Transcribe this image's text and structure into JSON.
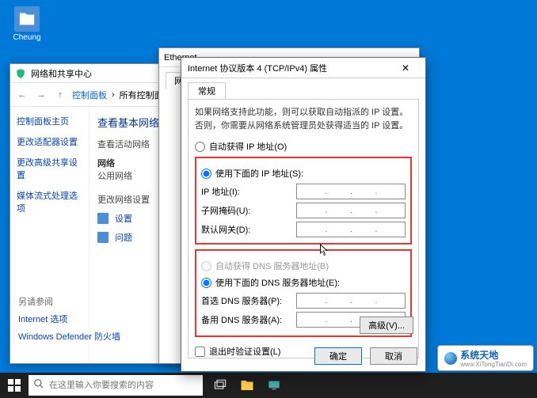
{
  "desktop": {
    "user_label": "Cheung"
  },
  "cp": {
    "title": "网络和共享中心",
    "crumbs": {
      "c1": "控制面板",
      "c2": "所有控制面板"
    },
    "side": {
      "home": "控制面板主页",
      "adapter": "更改适配器设置",
      "sharing": "更改高级共享设置",
      "media": "媒体流式处理选项"
    },
    "main": {
      "heading": "查看基本网络",
      "netinfo": "查看活动网络",
      "net_label": "网络",
      "net_type": "公用网络",
      "change_head": "更改网络设置",
      "setup": "设置",
      "diag": "问题"
    },
    "see": {
      "title": "另请参阅",
      "l1": "Internet 选项",
      "l2": "Windows Defender 防火墙"
    }
  },
  "eth": {
    "title": "Ethernet",
    "tab": "网络"
  },
  "tcp": {
    "title": "Internet 协议版本 4 (TCP/IPv4) 属性",
    "tab": "常规",
    "desc": "如果网络支持此功能，则可以获取自动指派的 IP 设置。否则，你需要从网络系统管理员处获得适当的 IP 设置。",
    "auto_ip": "自动获得 IP 地址(O)",
    "use_ip": "使用下面的 IP 地址(S):",
    "ip_label": "IP 地址(I):",
    "mask_label": "子网掩码(U):",
    "gw_label": "默认网关(D):",
    "auto_dns": "自动获得 DNS 服务器地址(B)",
    "use_dns": "使用下面的 DNS 服务器地址(E):",
    "dns1_label": "首选 DNS 服务器(P):",
    "dns2_label": "备用 DNS 服务器(A):",
    "validate": "退出时验证设置(L)",
    "advanced": "高级(V)...",
    "ok": "确定",
    "cancel": "取消"
  },
  "taskbar": {
    "search_placeholder": "在这里输入你要搜索的内容"
  },
  "watermark": {
    "brand": "系统天地",
    "url": "www.XiTongTianDi.com"
  }
}
